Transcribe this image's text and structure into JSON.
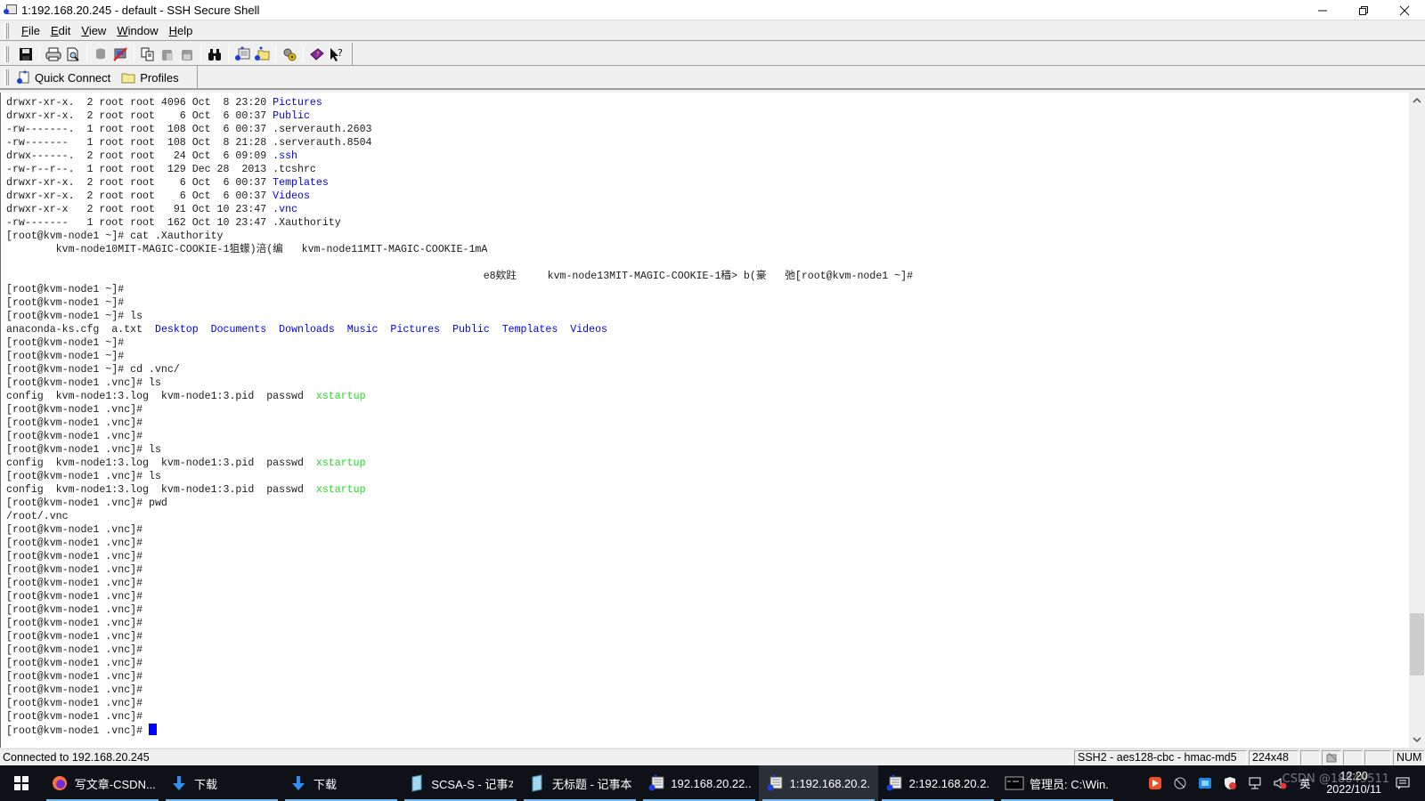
{
  "window": {
    "title": "1:192.168.20.245 - default - SSH Secure Shell",
    "controls": {
      "minimize": "minimize",
      "restore": "restore",
      "close": "close"
    }
  },
  "menubar": {
    "items": [
      {
        "label": "File",
        "accel": "F"
      },
      {
        "label": "Edit",
        "accel": "E"
      },
      {
        "label": "View",
        "accel": "V"
      },
      {
        "label": "Window",
        "accel": "W"
      },
      {
        "label": "Help",
        "accel": "H"
      }
    ]
  },
  "toolbar": {
    "buttons": [
      "save-icon",
      "print-icon",
      "print-preview-icon",
      "connect-icon",
      "disconnect-icon",
      "copy-icon",
      "paste-icon",
      "paste-disabled-icon",
      "find-icon",
      "new-terminal-icon",
      "new-file-transfer-icon",
      "settings-icon",
      "help-book-icon",
      "context-help-icon"
    ]
  },
  "quickbar": {
    "quick_connect": "Quick Connect",
    "profiles": "Profiles"
  },
  "terminal": {
    "lines": [
      [
        {
          "t": "drwxr-xr-x.  2 root root 4096 Oct  8 23:20 "
        },
        {
          "t": "Pictures",
          "c": "blue"
        }
      ],
      [
        {
          "t": "drwxr-xr-x.  2 root root    6 Oct  6 00:37 "
        },
        {
          "t": "Public",
          "c": "blue"
        }
      ],
      [
        {
          "t": "-rw-------.  1 root root  108 Oct  6 00:37 .serverauth.2603"
        }
      ],
      [
        {
          "t": "-rw-------   1 root root  108 Oct  8 21:28 .serverauth.8504"
        }
      ],
      [
        {
          "t": "drwx------.  2 root root   24 Oct  6 09:09 "
        },
        {
          "t": ".ssh",
          "c": "blue"
        }
      ],
      [
        {
          "t": "-rw-r--r--.  1 root root  129 Dec 28  2013 .tcshrc"
        }
      ],
      [
        {
          "t": "drwxr-xr-x.  2 root root    6 Oct  6 00:37 "
        },
        {
          "t": "Templates",
          "c": "blue"
        }
      ],
      [
        {
          "t": "drwxr-xr-x.  2 root root    6 Oct  6 00:37 "
        },
        {
          "t": "Videos",
          "c": "blue"
        }
      ],
      [
        {
          "t": "drwxr-xr-x   2 root root   91 Oct 10 23:47 "
        },
        {
          "t": ".vnc",
          "c": "blue"
        }
      ],
      [
        {
          "t": "-rw-------   1 root root  162 Oct 10 23:47 .Xauthority"
        }
      ],
      [
        {
          "t": "[root@kvm-node1 ~]# cat .Xauthority"
        }
      ],
      [
        {
          "t": "        kvm-node10MIT-MAGIC-COOKIE-1狙蠓)涪(编   kvm-node11MIT-MAGIC-COOKIE-1mA"
        }
      ],
      [
        {
          "t": ""
        }
      ],
      [
        {
          "t": "                                                                             e8欸跓     kvm-node13MIT-MAGIC-COOKIE-1穑> b(豪   弛[root@kvm-node1 ~]#"
        }
      ],
      [
        {
          "t": "[root@kvm-node1 ~]#"
        }
      ],
      [
        {
          "t": "[root@kvm-node1 ~]#"
        }
      ],
      [
        {
          "t": "[root@kvm-node1 ~]# ls"
        }
      ],
      [
        {
          "t": "anaconda-ks.cfg  a.txt  "
        },
        {
          "t": "Desktop",
          "c": "blue"
        },
        {
          "t": "  "
        },
        {
          "t": "Documents",
          "c": "blue"
        },
        {
          "t": "  "
        },
        {
          "t": "Downloads",
          "c": "blue"
        },
        {
          "t": "  "
        },
        {
          "t": "Music",
          "c": "blue"
        },
        {
          "t": "  "
        },
        {
          "t": "Pictures",
          "c": "blue"
        },
        {
          "t": "  "
        },
        {
          "t": "Public",
          "c": "blue"
        },
        {
          "t": "  "
        },
        {
          "t": "Templates",
          "c": "blue"
        },
        {
          "t": "  "
        },
        {
          "t": "Videos",
          "c": "blue"
        }
      ],
      [
        {
          "t": "[root@kvm-node1 ~]#"
        }
      ],
      [
        {
          "t": "[root@kvm-node1 ~]#"
        }
      ],
      [
        {
          "t": "[root@kvm-node1 ~]# cd .vnc/"
        }
      ],
      [
        {
          "t": "[root@kvm-node1 .vnc]# ls"
        }
      ],
      [
        {
          "t": "config  kvm-node1:3.log  kvm-node1:3.pid  passwd  "
        },
        {
          "t": "xstartup",
          "c": "green"
        }
      ],
      [
        {
          "t": "[root@kvm-node1 .vnc]#"
        }
      ],
      [
        {
          "t": "[root@kvm-node1 .vnc]#"
        }
      ],
      [
        {
          "t": "[root@kvm-node1 .vnc]#"
        }
      ],
      [
        {
          "t": "[root@kvm-node1 .vnc]# ls"
        }
      ],
      [
        {
          "t": "config  kvm-node1:3.log  kvm-node1:3.pid  passwd  "
        },
        {
          "t": "xstartup",
          "c": "green"
        }
      ],
      [
        {
          "t": "[root@kvm-node1 .vnc]# ls"
        }
      ],
      [
        {
          "t": "config  kvm-node1:3.log  kvm-node1:3.pid  passwd  "
        },
        {
          "t": "xstartup",
          "c": "green"
        }
      ],
      [
        {
          "t": "[root@kvm-node1 .vnc]# pwd"
        }
      ],
      [
        {
          "t": "/root/.vnc"
        }
      ],
      [
        {
          "t": "[root@kvm-node1 .vnc]#"
        }
      ],
      [
        {
          "t": "[root@kvm-node1 .vnc]#"
        }
      ],
      [
        {
          "t": "[root@kvm-node1 .vnc]#"
        }
      ],
      [
        {
          "t": "[root@kvm-node1 .vnc]#"
        }
      ],
      [
        {
          "t": "[root@kvm-node1 .vnc]#"
        }
      ],
      [
        {
          "t": "[root@kvm-node1 .vnc]#"
        }
      ],
      [
        {
          "t": "[root@kvm-node1 .vnc]#"
        }
      ],
      [
        {
          "t": "[root@kvm-node1 .vnc]#"
        }
      ],
      [
        {
          "t": "[root@kvm-node1 .vnc]#"
        }
      ],
      [
        {
          "t": "[root@kvm-node1 .vnc]#"
        }
      ],
      [
        {
          "t": "[root@kvm-node1 .vnc]#"
        }
      ],
      [
        {
          "t": "[root@kvm-node1 .vnc]#"
        }
      ],
      [
        {
          "t": "[root@kvm-node1 .vnc]#"
        }
      ],
      [
        {
          "t": "[root@kvm-node1 .vnc]#"
        }
      ],
      [
        {
          "t": "[root@kvm-node1 .vnc]#"
        }
      ],
      [
        {
          "t": "[root@kvm-node1 .vnc]# "
        },
        {
          "cursor": true
        }
      ]
    ],
    "colors": {
      "blue": "#0000ee",
      "green": "#22dd22",
      "cursor": "#0000ff"
    },
    "scroll_position_fraction": 0.9
  },
  "statusbar": {
    "connection": "Connected to 192.168.20.245",
    "cipher": "SSH2 - aes128-cbc - hmac-md5",
    "size": "224x48",
    "num": "NUM"
  },
  "taskbar": {
    "items": [
      {
        "label": "写文章-CSDN...",
        "icon": "firefox-icon"
      },
      {
        "label": "下载",
        "icon": "download-icon"
      },
      {
        "label": "下载",
        "icon": "download-icon"
      },
      {
        "label": "SCSA-S - 记事本",
        "icon": "notepad-icon"
      },
      {
        "label": "无标题 - 记事本",
        "icon": "notepad-icon"
      },
      {
        "label": "192.168.20.22...",
        "icon": "ssh-terminal-icon"
      },
      {
        "label": "1:192.168.20.2...",
        "icon": "ssh-terminal-icon",
        "active": true
      },
      {
        "label": "2:192.168.20.2...",
        "icon": "ssh-terminal-icon"
      },
      {
        "label": "管理员: C:\\Win...",
        "icon": "cmd-icon"
      }
    ],
    "tray": {
      "ime": "英",
      "time": "12:20",
      "date": "2022/10/11"
    },
    "watermark": "CSDN @18849511"
  }
}
